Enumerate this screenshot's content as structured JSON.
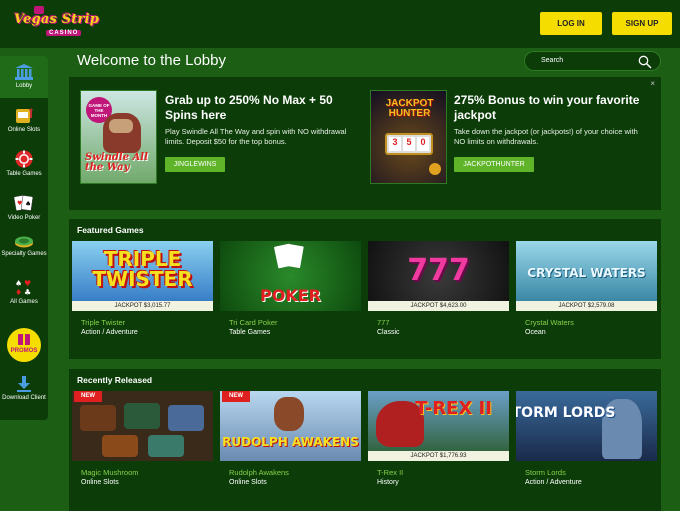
{
  "logo": {
    "name": "Vegas Strip",
    "sub": "CASINO"
  },
  "header": {
    "login_label": "LOG IN",
    "signup_label": "SIGN UP"
  },
  "sidebar": {
    "items": [
      {
        "label": "Lobby",
        "icon": "bank-icon"
      },
      {
        "label": "Online Slots",
        "icon": "slot-machine-icon"
      },
      {
        "label": "Table Games",
        "icon": "poker-chip-icon"
      },
      {
        "label": "Video Poker",
        "icon": "playing-cards-icon"
      },
      {
        "label": "Specialty Games",
        "icon": "specialty-games-icon"
      },
      {
        "label": "All Games",
        "icon": "card-suits-icon"
      }
    ],
    "promos_label": "PROMOS",
    "download_label": "Download Client"
  },
  "main": {
    "title": "Welcome to the Lobby",
    "search": {
      "label": "Search"
    },
    "close_label": "×"
  },
  "promos": [
    {
      "image_text": "GAME OF THE MONTH",
      "image_title": "Swindle All the Way",
      "title": "Grab up to 250% No Max + 50 Spins here",
      "description": "Play Swindle All The Way and spin with NO withdrawal limits. Deposit $50 for the top bonus.",
      "code": "JINGLEWINS"
    },
    {
      "image_title": "JACKPOT HUNTER",
      "title": "275% Bonus to win your favorite jackpot",
      "description": "Take down the jackpot (or jackpots!) of your choice with NO limits on withdrawals.",
      "code": "JACKPOTHUNTER"
    }
  ],
  "featured": {
    "title": "Featured Games",
    "games": [
      {
        "name": "Triple Twister",
        "category": "Action / Adventure",
        "jackpot": "JACKPOT $3,015.77",
        "art": "TRIPLE TWISTER",
        "color": "#3b8fd8"
      },
      {
        "name": "Tri Card Poker",
        "category": "Table Games",
        "jackpot": "",
        "art": "POKER",
        "color": "#1f6b1a"
      },
      {
        "name": "777",
        "category": "Classic",
        "jackpot": "JACKPOT $4,623.00",
        "art": "777",
        "color": "#222222"
      },
      {
        "name": "Crystal Waters",
        "category": "Ocean",
        "jackpot": "JACKPOT $2,579.08",
        "art": "CRYSTAL WATERS",
        "color": "#3d8fb0"
      }
    ]
  },
  "recent": {
    "title": "Recently Released",
    "games": [
      {
        "name": "Magic Mushroom",
        "category": "Online Slots",
        "jackpot": "",
        "badge": "NEW",
        "art": "",
        "color": "#3a2a1a"
      },
      {
        "name": "Rudolph Awakens",
        "category": "Online Slots",
        "jackpot": "",
        "badge": "NEW",
        "art": "RUDOLPH AWAKENS",
        "color": "#7a3a2a"
      },
      {
        "name": "T-Rex II",
        "category": "History",
        "jackpot": "JACKPOT $1,776.93",
        "badge": "",
        "art": "T-REX II",
        "color": "#3a5a2a"
      },
      {
        "name": "Storm Lords",
        "category": "Action / Adventure",
        "jackpot": "",
        "badge": "",
        "art": "STORM LORDS",
        "color": "#2a4a6a"
      }
    ]
  }
}
